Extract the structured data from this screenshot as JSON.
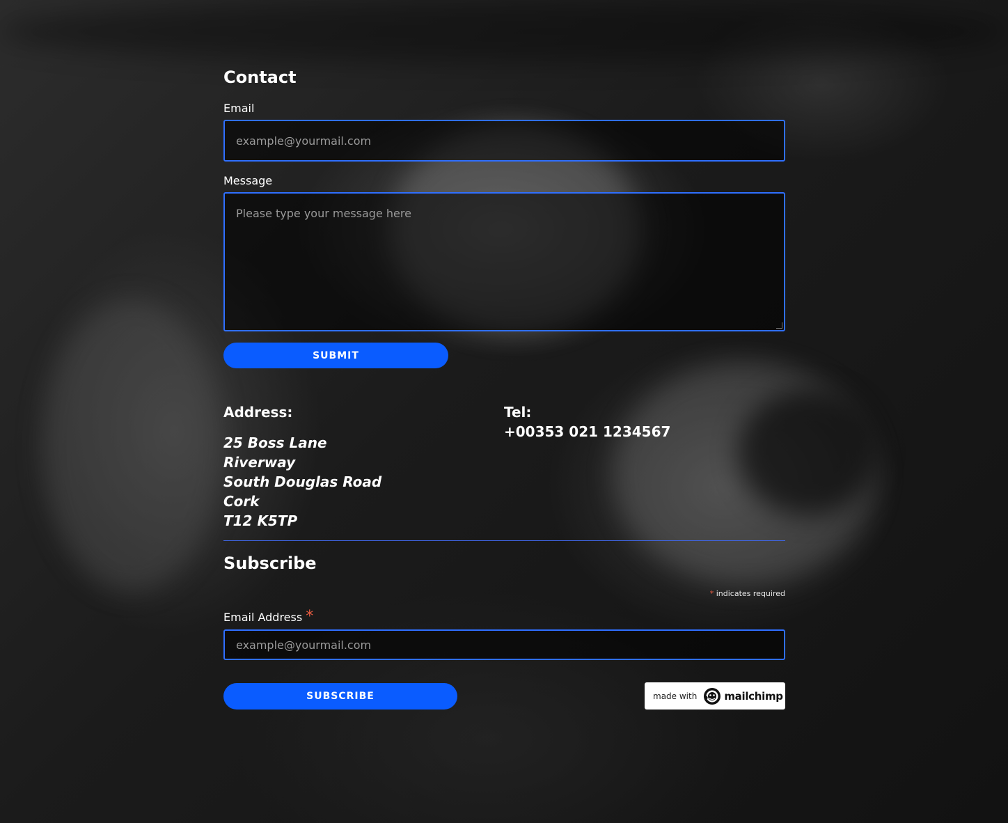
{
  "contact": {
    "title": "Contact",
    "email_label": "Email",
    "email_placeholder": "example@yourmail.com",
    "message_label": "Message",
    "message_placeholder": "Please type your message here",
    "submit_label": "SUBMIT"
  },
  "address": {
    "heading": "Address:",
    "lines": [
      "25 Boss Lane",
      "Riverway",
      "South Douglas Road",
      "Cork",
      "T12 K5TP"
    ]
  },
  "tel": {
    "heading": "Tel:",
    "number": "+00353 021 1234567"
  },
  "subscribe": {
    "title": "Subscribe",
    "required_asterisk": "*",
    "required_note": "indicates required",
    "email_label": "Email Address",
    "email_placeholder": "example@yourmail.com",
    "button_label": "SUBSCRIBE"
  },
  "badge": {
    "made_with": "made with",
    "brand": "mailchimp",
    "icon": "mailchimp-freddie-icon"
  },
  "colors": {
    "accent": "#0a5cff",
    "input_border": "#2f6fff",
    "required": "#e85c41"
  }
}
